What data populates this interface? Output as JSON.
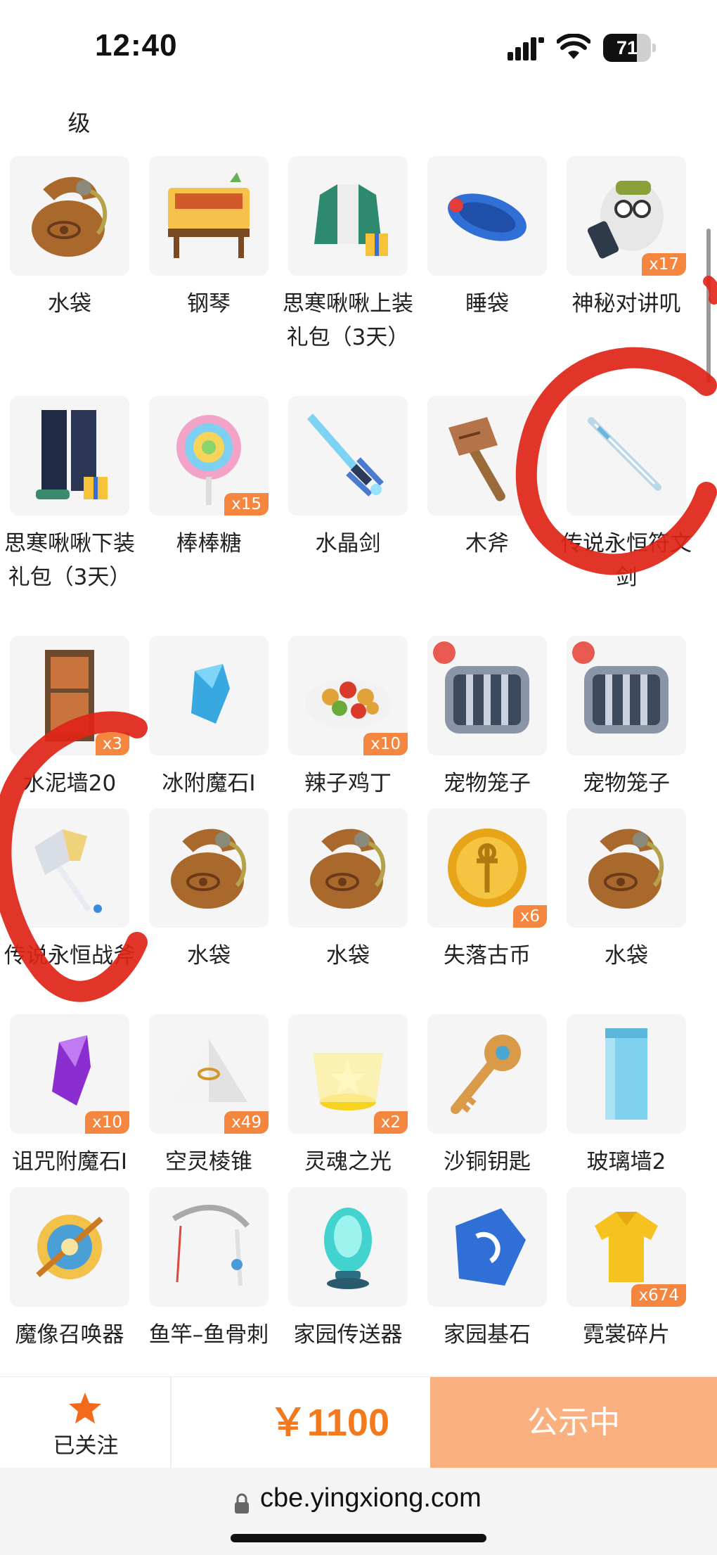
{
  "status_bar": {
    "time": "12:40",
    "battery_level": "71",
    "battery_fraction": 0.71
  },
  "prev_row_label": "级",
  "items": [
    {
      "label": "水袋",
      "badge": "",
      "icon": "water-bag-icon"
    },
    {
      "label": "钢琴",
      "badge": "",
      "icon": "piano-icon"
    },
    {
      "label": "思寒啾啾上装礼包（3天）",
      "badge": "",
      "icon": "outfit-top-gift-icon"
    },
    {
      "label": "睡袋",
      "badge": "",
      "icon": "sleeping-bag-icon"
    },
    {
      "label": "神秘对讲叽",
      "badge": "x17",
      "icon": "walkie-talkie-icon"
    },
    {
      "label": "思寒啾啾下装礼包（3天）",
      "badge": "",
      "icon": "outfit-bottom-gift-icon"
    },
    {
      "label": "棒棒糖",
      "badge": "x15",
      "icon": "lollipop-icon"
    },
    {
      "label": "水晶剑",
      "badge": "",
      "icon": "crystal-sword-icon"
    },
    {
      "label": "木斧",
      "badge": "",
      "icon": "wooden-axe-icon"
    },
    {
      "label": "传说永恒符文剑",
      "badge": "",
      "icon": "rune-sword-icon"
    },
    {
      "label": "水泥墙20",
      "badge": "x3",
      "icon": "cement-wall-icon"
    },
    {
      "label": "冰附魔石I",
      "badge": "",
      "icon": "ice-enchant-stone-icon"
    },
    {
      "label": "辣子鸡丁",
      "badge": "x10",
      "icon": "spicy-chicken-icon"
    },
    {
      "label": "宠物笼子",
      "badge": "",
      "icon": "pet-cage-icon"
    },
    {
      "label": "宠物笼子",
      "badge": "",
      "icon": "pet-cage-icon"
    },
    {
      "label": "传说永恒战斧",
      "badge": "",
      "icon": "battle-axe-icon"
    },
    {
      "label": "水袋",
      "badge": "",
      "icon": "water-bag-icon"
    },
    {
      "label": "水袋",
      "badge": "",
      "icon": "water-bag-icon"
    },
    {
      "label": "失落古币",
      "badge": "x6",
      "icon": "ancient-coin-icon"
    },
    {
      "label": "水袋",
      "badge": "",
      "icon": "water-bag-icon"
    },
    {
      "label": "诅咒附魔石I",
      "badge": "x10",
      "icon": "curse-enchant-stone-icon"
    },
    {
      "label": "空灵棱锥",
      "badge": "x49",
      "icon": "pyramid-icon"
    },
    {
      "label": "灵魂之光",
      "badge": "x2",
      "icon": "soul-light-icon"
    },
    {
      "label": "沙铜钥匙",
      "badge": "",
      "icon": "bronze-key-icon"
    },
    {
      "label": "玻璃墙2",
      "badge": "",
      "icon": "glass-wall-icon"
    },
    {
      "label": "魔像召唤器",
      "badge": "",
      "icon": "golem-summoner-icon"
    },
    {
      "label": "鱼竿–鱼骨刺",
      "badge": "",
      "icon": "fishing-rod-icon"
    },
    {
      "label": "家园传送器",
      "badge": "",
      "icon": "teleporter-icon"
    },
    {
      "label": "家园基石",
      "badge": "",
      "icon": "home-stone-icon"
    },
    {
      "label": "霓裳碎片",
      "badge": "x674",
      "icon": "clothing-shard-icon"
    }
  ],
  "bottom_bar": {
    "follow_label": "已关注",
    "price": "￥1100",
    "status_button": "公示中"
  },
  "url_bar": {
    "url": "cbe.yingxiong.com"
  },
  "colors": {
    "accent": "#f2791e",
    "badge": "#f4863f",
    "status_button": "#fbb07f",
    "annotation": "#e02418"
  }
}
